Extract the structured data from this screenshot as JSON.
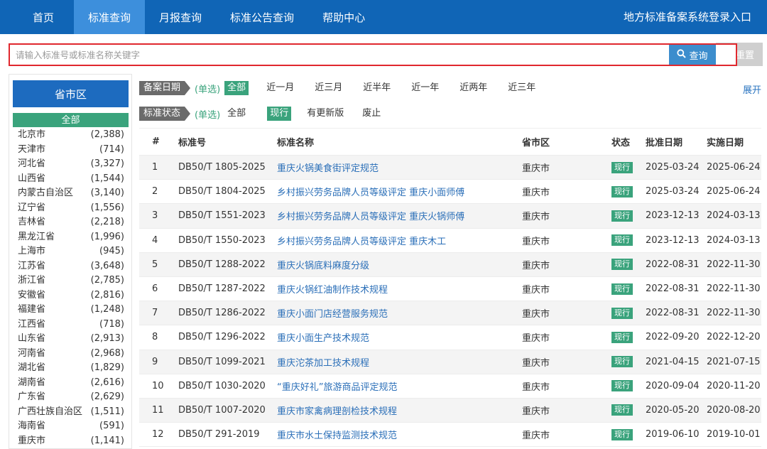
{
  "nav": {
    "items": [
      "首页",
      "标准查询",
      "月报查询",
      "标准公告查询",
      "帮助中心"
    ],
    "active_index": 1,
    "login": "地方标准备案系统登录入口"
  },
  "search": {
    "placeholder": "请输入标准号或标准名称关键字",
    "value": "",
    "search_label": "查询",
    "reset_label": "重置",
    "search_icon": "search-icon",
    "reset_icon": "refresh-icon"
  },
  "sidebar": {
    "title": "省市区",
    "all_label": "全部",
    "items": [
      {
        "name": "北京市",
        "count": "(2,388)"
      },
      {
        "name": "天津市",
        "count": "(714)"
      },
      {
        "name": "河北省",
        "count": "(3,327)"
      },
      {
        "name": "山西省",
        "count": "(1,544)"
      },
      {
        "name": "内蒙古自治区",
        "count": "(3,140)"
      },
      {
        "name": "辽宁省",
        "count": "(1,556)"
      },
      {
        "name": "吉林省",
        "count": "(2,218)"
      },
      {
        "name": "黑龙江省",
        "count": "(1,996)"
      },
      {
        "name": "上海市",
        "count": "(945)"
      },
      {
        "name": "江苏省",
        "count": "(3,648)"
      },
      {
        "name": "浙江省",
        "count": "(2,785)"
      },
      {
        "name": "安徽省",
        "count": "(2,816)"
      },
      {
        "name": "福建省",
        "count": "(1,248)"
      },
      {
        "name": "江西省",
        "count": "(718)"
      },
      {
        "name": "山东省",
        "count": "(2,913)"
      },
      {
        "name": "河南省",
        "count": "(2,968)"
      },
      {
        "name": "湖北省",
        "count": "(1,829)"
      },
      {
        "name": "湖南省",
        "count": "(2,616)"
      },
      {
        "name": "广东省",
        "count": "(2,629)"
      },
      {
        "name": "广西壮族自治区",
        "count": "(1,511)"
      },
      {
        "name": "海南省",
        "count": "(591)"
      },
      {
        "name": "重庆市",
        "count": "(1,141)"
      }
    ]
  },
  "filters": {
    "date": {
      "label": "备案日期",
      "mode": "(单选)",
      "options": [
        "全部",
        "近一月",
        "近三月",
        "近半年",
        "近一年",
        "近两年",
        "近三年"
      ],
      "selected": 0
    },
    "status": {
      "label": "标准状态",
      "mode": "(单选)",
      "options": [
        "全部",
        "现行",
        "有更新版",
        "废止"
      ],
      "selected": 1
    },
    "expand": "展开"
  },
  "table": {
    "headers": [
      "#",
      "标准号",
      "标准名称",
      "省市区",
      "状态",
      "批准日期",
      "实施日期"
    ],
    "rows": [
      [
        "1",
        "DB50/T 1805-2025",
        "重庆火锅美食街评定规范",
        "重庆市",
        "现行",
        "2025-03-24",
        "2025-06-24"
      ],
      [
        "2",
        "DB50/T 1804-2025",
        "乡村振兴劳务品牌人员等级评定 重庆小面师傅",
        "重庆市",
        "现行",
        "2025-03-24",
        "2025-06-24"
      ],
      [
        "3",
        "DB50/T 1551-2023",
        "乡村振兴劳务品牌人员等级评定 重庆火锅师傅",
        "重庆市",
        "现行",
        "2023-12-13",
        "2024-03-13"
      ],
      [
        "4",
        "DB50/T 1550-2023",
        "乡村振兴劳务品牌人员等级评定 重庆木工",
        "重庆市",
        "现行",
        "2023-12-13",
        "2024-03-13"
      ],
      [
        "5",
        "DB50/T 1288-2022",
        "重庆火锅底料麻度分级",
        "重庆市",
        "现行",
        "2022-08-31",
        "2022-11-30"
      ],
      [
        "6",
        "DB50/T 1287-2022",
        "重庆火锅红油制作技术规程",
        "重庆市",
        "现行",
        "2022-08-31",
        "2022-11-30"
      ],
      [
        "7",
        "DB50/T 1286-2022",
        "重庆小面门店经营服务规范",
        "重庆市",
        "现行",
        "2022-08-31",
        "2022-11-30"
      ],
      [
        "8",
        "DB50/T 1296-2022",
        "重庆小面生产技术规范",
        "重庆市",
        "现行",
        "2022-09-20",
        "2022-12-20"
      ],
      [
        "9",
        "DB50/T 1099-2021",
        "重庆沱茶加工技术规程",
        "重庆市",
        "现行",
        "2021-04-15",
        "2021-07-15"
      ],
      [
        "10",
        "DB50/T 1030-2020",
        "“重庆好礼”旅游商品评定规范",
        "重庆市",
        "现行",
        "2020-09-04",
        "2020-11-20"
      ],
      [
        "11",
        "DB50/T 1007-2020",
        "重庆市家禽病理剖检技术规程",
        "重庆市",
        "现行",
        "2020-05-20",
        "2020-08-20"
      ],
      [
        "12",
        "DB50/T 291-2019",
        "重庆市水土保持监测技术规范",
        "重庆市",
        "现行",
        "2019-06-10",
        "2019-10-01"
      ]
    ]
  }
}
